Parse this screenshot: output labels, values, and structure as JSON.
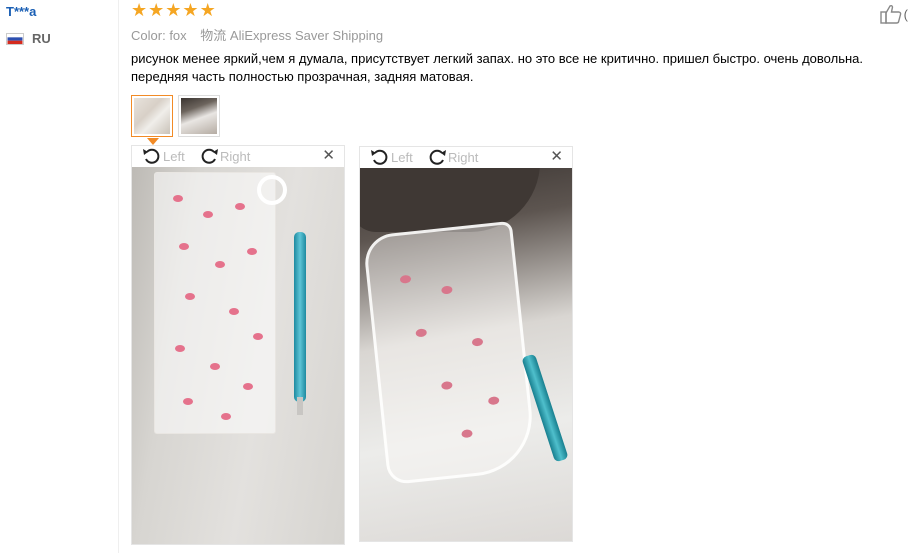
{
  "reviewer": {
    "name": "T***a",
    "country_code": "RU"
  },
  "review": {
    "rating": 5,
    "stars": [
      "★",
      "★",
      "★",
      "★",
      "★"
    ],
    "color_label": "Color:",
    "color_value": "fox",
    "shipping_label": "物流",
    "shipping_value": "AliExpress Saver Shipping",
    "text": "рисунок менее яркий,чем я думала, присутствует легкий запах. но это все не критично. пришел быстро. очень довольна. передняя часть полностью прозрачная, задняя матовая.",
    "helpful_count": "("
  },
  "viewer": {
    "rotate_left_label": "Left",
    "rotate_right_label": "Right",
    "close_glyph": "✕"
  },
  "colors": {
    "accent": "#f28b26",
    "star": "#f5a623",
    "link": "#1a5fb4"
  }
}
